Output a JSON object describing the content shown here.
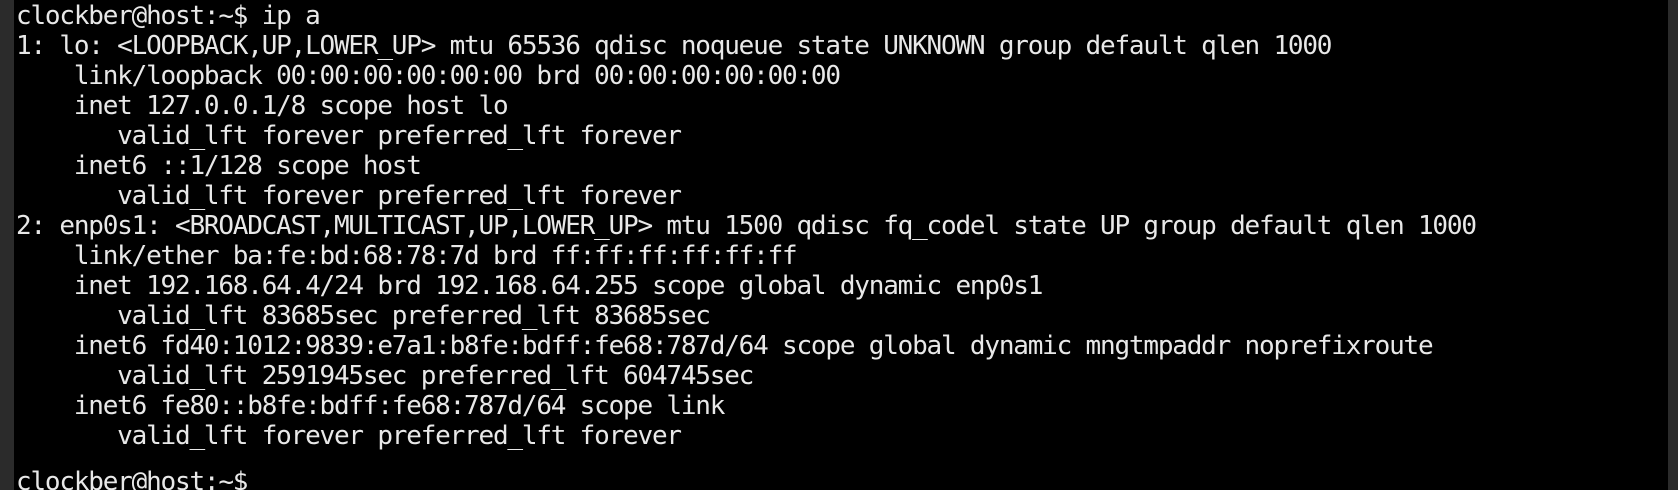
{
  "terminal": {
    "lines": [
      "clockber@host:~$ ip a",
      "1: lo: <LOOPBACK,UP,LOWER_UP> mtu 65536 qdisc noqueue state UNKNOWN group default qlen 1000",
      "    link/loopback 00:00:00:00:00:00 brd 00:00:00:00:00:00",
      "    inet 127.0.0.1/8 scope host lo",
      "       valid_lft forever preferred_lft forever",
      "    inet6 ::1/128 scope host",
      "       valid_lft forever preferred_lft forever",
      "2: enp0s1: <BROADCAST,MULTICAST,UP,LOWER_UP> mtu 1500 qdisc fq_codel state UP group default qlen 1000",
      "    link/ether ba:fe:bd:68:78:7d brd ff:ff:ff:ff:ff:ff",
      "    inet 192.168.64.4/24 brd 192.168.64.255 scope global dynamic enp0s1",
      "       valid_lft 83685sec preferred_lft 83685sec",
      "    inet6 fd40:1012:9839:e7a1:b8fe:bdff:fe68:787d/64 scope global dynamic mngtmpaddr noprefixroute",
      "       valid_lft 2591945sec preferred_lft 604745sec",
      "    inet6 fe80::b8fe:bdff:fe68:787d/64 scope link",
      "       valid_lft forever preferred_lft forever",
      "clockber@host:~$"
    ]
  }
}
